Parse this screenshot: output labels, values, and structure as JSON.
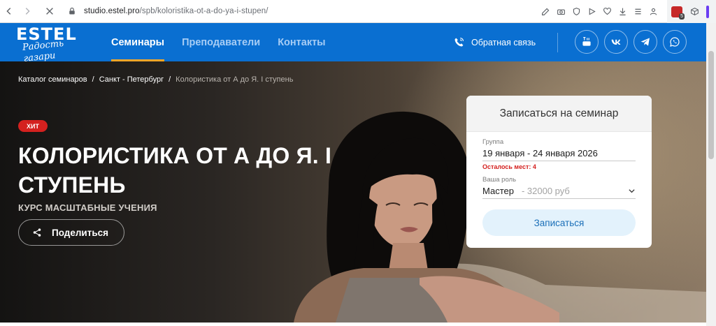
{
  "browser": {
    "url_host": "studio.estel.pro",
    "url_path": "/spb/koloristika-ot-a-do-ya-i-stupen/",
    "extension_badge": "5"
  },
  "header": {
    "logo_word": "ESTEL",
    "logo_script": "Радость газари",
    "nav": [
      "Семинары",
      "Преподаватели",
      "Контакты"
    ],
    "active_nav": "Семинары",
    "callback_label": "Обратная связь",
    "socials": [
      "youtube-icon",
      "vk-icon",
      "telegram-icon",
      "whatsapp-icon"
    ],
    "brand_color": "#0a6fd1",
    "accent_color": "#f4a62a"
  },
  "breadcrumb": [
    "Каталог семинаров",
    "Санкт - Петербург",
    "Колористика от А до Я. I ступень"
  ],
  "hero": {
    "badge": "ХИТ",
    "title": "КОЛОРИСТИКА ОТ А ДО Я. I СТУПЕНЬ",
    "subtitle": "КУРС МАСШТАБНЫЕ УЧЕНИЯ",
    "share_label": "Поделиться"
  },
  "signup": {
    "title": "Записаться на семинар",
    "group_label": "Группа",
    "group_value": "19 января - 24 января 2026",
    "seats_left": "Осталось мест: 4",
    "role_label": "Ваша роль",
    "role_value": "Мастер",
    "role_price": "- 32000 руб",
    "submit_label": "Записаться"
  }
}
